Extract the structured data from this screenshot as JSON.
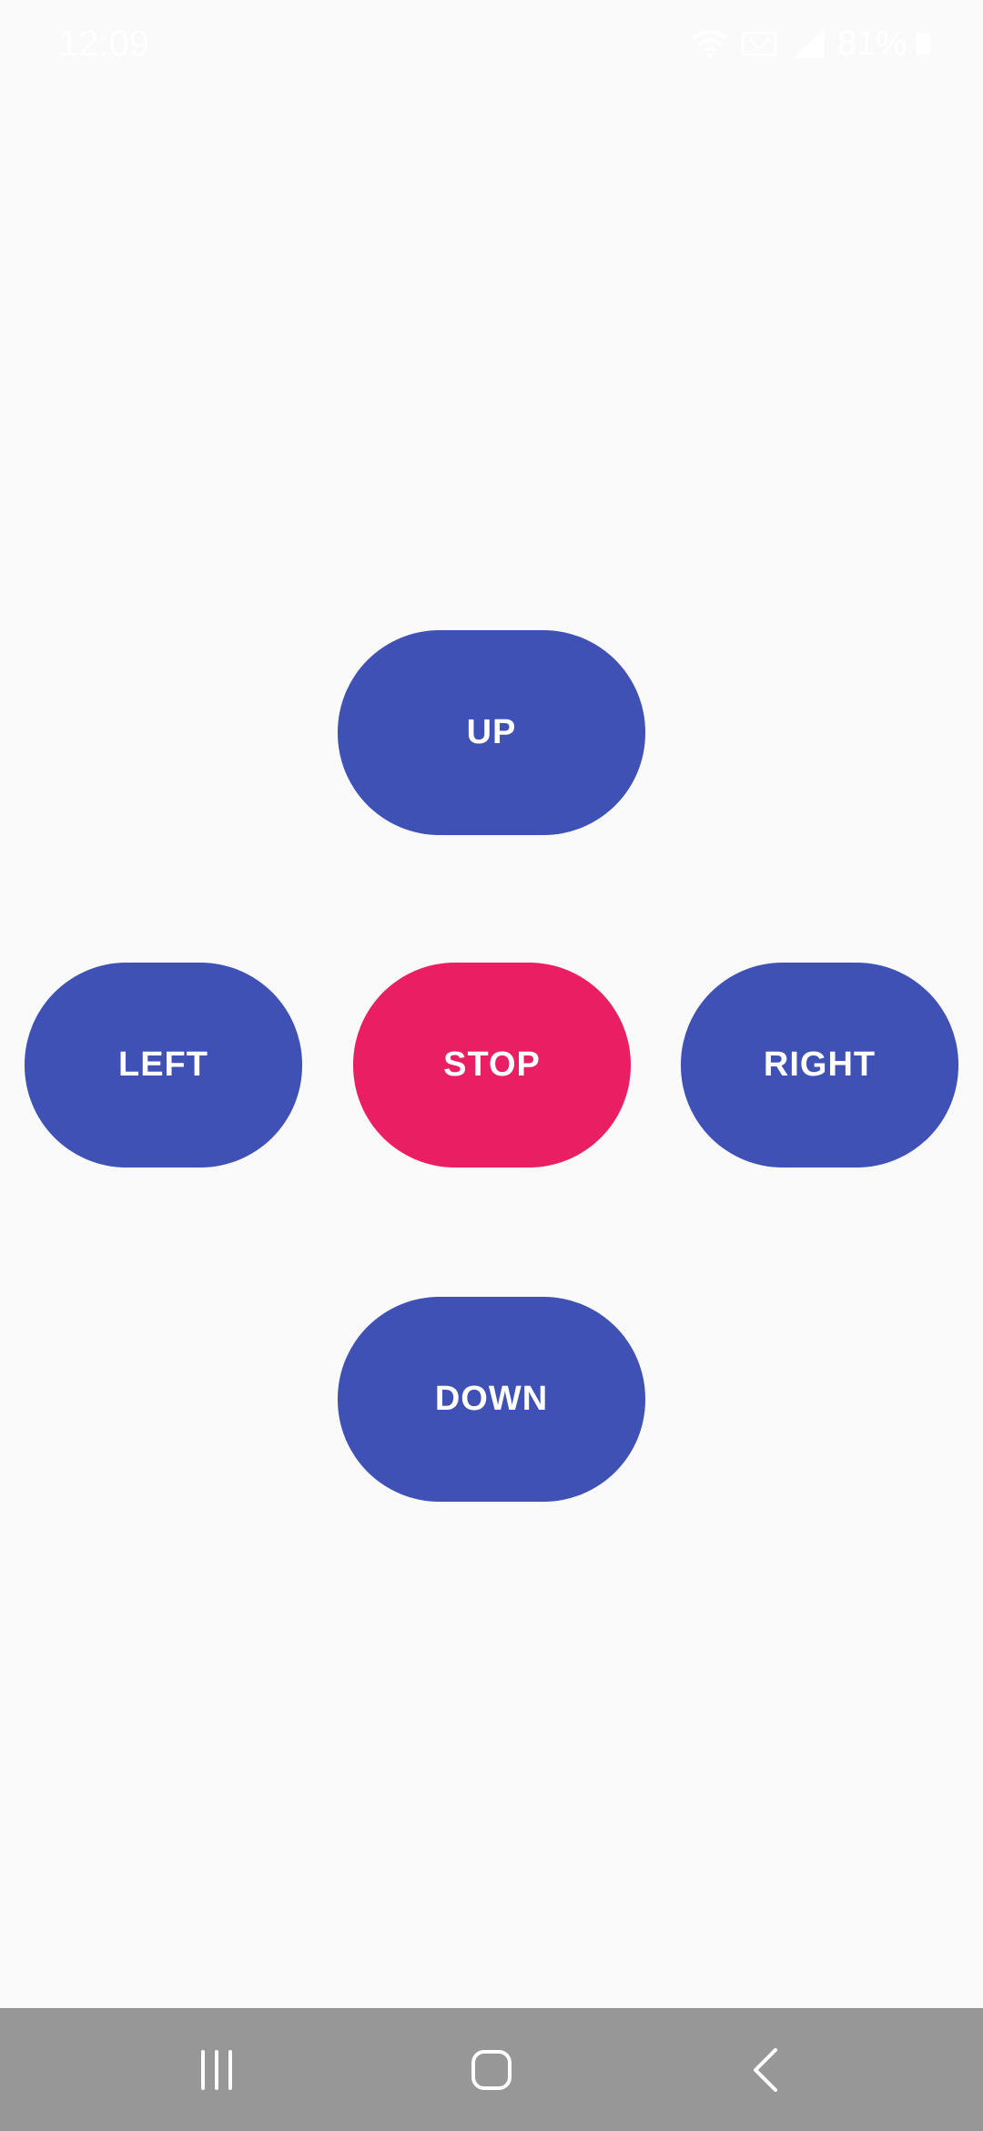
{
  "status_bar": {
    "time": "12:09",
    "battery_percent": "81%",
    "icons": [
      "wifi-icon",
      "volte-icon",
      "signal-icon",
      "battery-icon"
    ]
  },
  "controls": {
    "up_label": "UP",
    "left_label": "LEFT",
    "stop_label": "STOP",
    "right_label": "RIGHT",
    "down_label": "DOWN"
  },
  "colors": {
    "background": "#fafafa",
    "direction_button": "#3f51b5",
    "stop_button": "#e91e63",
    "button_text": "#ffffff",
    "nav_bar": "#979797"
  },
  "nav_bar": {
    "icons": [
      "recents-icon",
      "home-icon",
      "back-icon"
    ]
  }
}
